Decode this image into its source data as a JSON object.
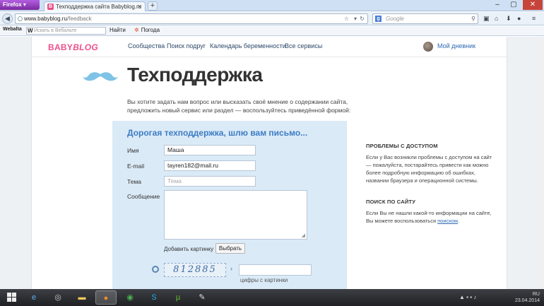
{
  "browser": {
    "app_button": "Firefox",
    "tab_title": "Техподдержка сайта Babyblog.ru",
    "new_tab": "+",
    "url_host": "www.babyblog.ru",
    "url_path": "/feedback",
    "search_placeholder": "Google",
    "window_controls": [
      "–",
      "▢",
      "✕"
    ],
    "toolbar_icons": [
      "bookmarks-icon",
      "home-icon",
      "download-icon",
      "addons-icon",
      "menu-icon"
    ]
  },
  "bookmarks": {
    "webalta": "Webalta",
    "search_placeholder": "Искать в Вебальте",
    "go": "Найти",
    "weather": "Погода"
  },
  "site": {
    "logo_baby": "BABY",
    "logo_blog": "BLOG",
    "nav": [
      "Сообщества",
      "Поиск подруг",
      "Календарь беременности",
      "Все сервисы"
    ],
    "my_diary": "Мой дневник",
    "title": "Техподдержка",
    "intro": "Вы хотите задать нам вопрос или высказать своё мнение о содержании сайта, предложить новый сервис или раздел — воспользуйтесь приведённой формой:"
  },
  "form": {
    "title": "Дорогая техподдержка, шлю вам письмо...",
    "name_label": "Имя",
    "name_value": "Маша",
    "email_label": "E-mail",
    "email_value": "tayren182@mail.ru",
    "subject_label": "Тема",
    "subject_placeholder": "Тема",
    "message_label": "Сообщение",
    "add_picture": "Добавить картинку",
    "choose_button": "Выбрать",
    "captcha_text": "812885",
    "captcha_hint": "цифры с картинки"
  },
  "sidebar": {
    "access_title": "ПРОБЛЕМЫ С ДОСТУПОМ",
    "access_text": "Если у Вас возникли проблемы с доступом на сайт — пожалуйста, постарайтесь привести как можно более подробную информацию об ошибках, названии браузера и операционной системы.",
    "search_title": "ПОИСК ПО САЙТУ",
    "search_text": "Если Вы не нашли какой-то информации на сайте, Вы можете воспользоваться",
    "search_link": "поиском",
    "search_end": "."
  },
  "taskbar": {
    "lang": "RU",
    "date": "23.04.2014"
  },
  "colors": {
    "brand_pink": "#ee4f8b",
    "accent_blue": "#3c7cc4",
    "form_bg": "#dbeaf7",
    "mustache": "#7fc3e6"
  }
}
